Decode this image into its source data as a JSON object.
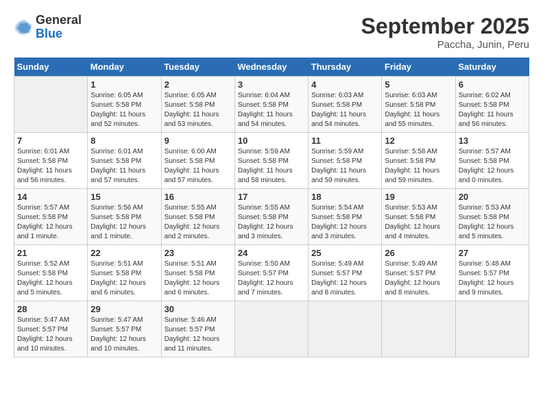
{
  "header": {
    "logo_general": "General",
    "logo_blue": "Blue",
    "month_title": "September 2025",
    "subtitle": "Paccha, Junin, Peru"
  },
  "calendar": {
    "days_of_week": [
      "Sunday",
      "Monday",
      "Tuesday",
      "Wednesday",
      "Thursday",
      "Friday",
      "Saturday"
    ],
    "weeks": [
      [
        {
          "day": "",
          "info": ""
        },
        {
          "day": "1",
          "info": "Sunrise: 6:05 AM\nSunset: 5:58 PM\nDaylight: 11 hours\nand 52 minutes."
        },
        {
          "day": "2",
          "info": "Sunrise: 6:05 AM\nSunset: 5:58 PM\nDaylight: 11 hours\nand 53 minutes."
        },
        {
          "day": "3",
          "info": "Sunrise: 6:04 AM\nSunset: 5:58 PM\nDaylight: 11 hours\nand 54 minutes."
        },
        {
          "day": "4",
          "info": "Sunrise: 6:03 AM\nSunset: 5:58 PM\nDaylight: 11 hours\nand 54 minutes."
        },
        {
          "day": "5",
          "info": "Sunrise: 6:03 AM\nSunset: 5:58 PM\nDaylight: 11 hours\nand 55 minutes."
        },
        {
          "day": "6",
          "info": "Sunrise: 6:02 AM\nSunset: 5:58 PM\nDaylight: 11 hours\nand 56 minutes."
        }
      ],
      [
        {
          "day": "7",
          "info": "Sunrise: 6:01 AM\nSunset: 5:58 PM\nDaylight: 11 hours\nand 56 minutes."
        },
        {
          "day": "8",
          "info": "Sunrise: 6:01 AM\nSunset: 5:58 PM\nDaylight: 11 hours\nand 57 minutes."
        },
        {
          "day": "9",
          "info": "Sunrise: 6:00 AM\nSunset: 5:58 PM\nDaylight: 11 hours\nand 57 minutes."
        },
        {
          "day": "10",
          "info": "Sunrise: 5:59 AM\nSunset: 5:58 PM\nDaylight: 11 hours\nand 58 minutes."
        },
        {
          "day": "11",
          "info": "Sunrise: 5:59 AM\nSunset: 5:58 PM\nDaylight: 11 hours\nand 59 minutes."
        },
        {
          "day": "12",
          "info": "Sunrise: 5:58 AM\nSunset: 5:58 PM\nDaylight: 11 hours\nand 59 minutes."
        },
        {
          "day": "13",
          "info": "Sunrise: 5:57 AM\nSunset: 5:58 PM\nDaylight: 12 hours\nand 0 minutes."
        }
      ],
      [
        {
          "day": "14",
          "info": "Sunrise: 5:57 AM\nSunset: 5:58 PM\nDaylight: 12 hours\nand 1 minute."
        },
        {
          "day": "15",
          "info": "Sunrise: 5:56 AM\nSunset: 5:58 PM\nDaylight: 12 hours\nand 1 minute."
        },
        {
          "day": "16",
          "info": "Sunrise: 5:55 AM\nSunset: 5:58 PM\nDaylight: 12 hours\nand 2 minutes."
        },
        {
          "day": "17",
          "info": "Sunrise: 5:55 AM\nSunset: 5:58 PM\nDaylight: 12 hours\nand 3 minutes."
        },
        {
          "day": "18",
          "info": "Sunrise: 5:54 AM\nSunset: 5:58 PM\nDaylight: 12 hours\nand 3 minutes."
        },
        {
          "day": "19",
          "info": "Sunrise: 5:53 AM\nSunset: 5:58 PM\nDaylight: 12 hours\nand 4 minutes."
        },
        {
          "day": "20",
          "info": "Sunrise: 5:53 AM\nSunset: 5:58 PM\nDaylight: 12 hours\nand 5 minutes."
        }
      ],
      [
        {
          "day": "21",
          "info": "Sunrise: 5:52 AM\nSunset: 5:58 PM\nDaylight: 12 hours\nand 5 minutes."
        },
        {
          "day": "22",
          "info": "Sunrise: 5:51 AM\nSunset: 5:58 PM\nDaylight: 12 hours\nand 6 minutes."
        },
        {
          "day": "23",
          "info": "Sunrise: 5:51 AM\nSunset: 5:58 PM\nDaylight: 12 hours\nand 6 minutes."
        },
        {
          "day": "24",
          "info": "Sunrise: 5:50 AM\nSunset: 5:57 PM\nDaylight: 12 hours\nand 7 minutes."
        },
        {
          "day": "25",
          "info": "Sunrise: 5:49 AM\nSunset: 5:57 PM\nDaylight: 12 hours\nand 8 minutes."
        },
        {
          "day": "26",
          "info": "Sunrise: 5:49 AM\nSunset: 5:57 PM\nDaylight: 12 hours\nand 8 minutes."
        },
        {
          "day": "27",
          "info": "Sunrise: 5:48 AM\nSunset: 5:57 PM\nDaylight: 12 hours\nand 9 minutes."
        }
      ],
      [
        {
          "day": "28",
          "info": "Sunrise: 5:47 AM\nSunset: 5:57 PM\nDaylight: 12 hours\nand 10 minutes."
        },
        {
          "day": "29",
          "info": "Sunrise: 5:47 AM\nSunset: 5:57 PM\nDaylight: 12 hours\nand 10 minutes."
        },
        {
          "day": "30",
          "info": "Sunrise: 5:46 AM\nSunset: 5:57 PM\nDaylight: 12 hours\nand 11 minutes."
        },
        {
          "day": "",
          "info": ""
        },
        {
          "day": "",
          "info": ""
        },
        {
          "day": "",
          "info": ""
        },
        {
          "day": "",
          "info": ""
        }
      ]
    ]
  }
}
